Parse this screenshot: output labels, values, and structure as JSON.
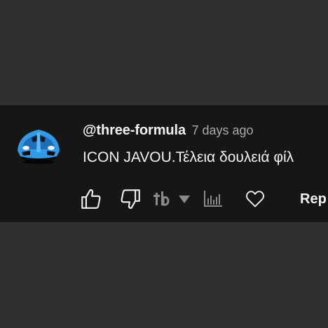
{
  "comment": {
    "author": "@three-formula",
    "timestamp": "7 days ago",
    "text": "ICON JAVOU.Τέλεια δουλειά φίλ",
    "avatar_icon": "blue-race-car-avatar"
  },
  "actions": {
    "like_icon": "thumbs-up-icon",
    "dislike_icon": "thumbs-down-icon",
    "extension_logo_icon": "tb-logo-icon",
    "extension_dropdown_icon": "caret-down-icon",
    "stats_icon": "bar-chart-icon",
    "heart_icon": "heart-icon",
    "reply_label": "Rep"
  },
  "colors": {
    "page_background": "#303030",
    "card_background": "#161616",
    "primary_text": "#f1f1f1",
    "secondary_text": "#aaaaaa",
    "muted_icon": "#8a8a8a",
    "avatar_blue": "#2f9be6"
  }
}
